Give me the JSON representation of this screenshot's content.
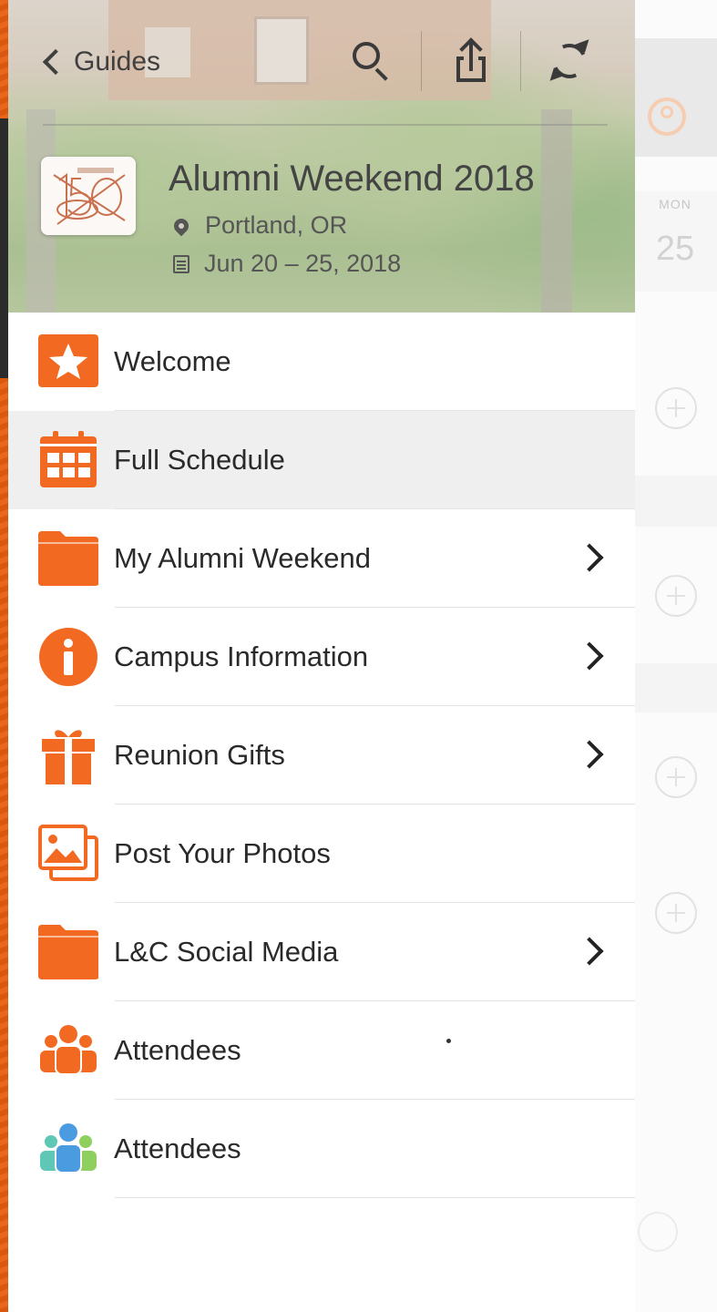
{
  "nav": {
    "back_label": "Guides",
    "actions": [
      "search-icon",
      "share-icon",
      "refresh-icon"
    ]
  },
  "event": {
    "title": "Alumni Weekend 2018",
    "location": "Portland, OR",
    "dates": "Jun 20 – 25, 2018",
    "logo_icon": "150-anniversary-logo"
  },
  "menu": {
    "items": [
      {
        "label": "Welcome",
        "icon": "star-icon",
        "has_chevron": false,
        "active": false
      },
      {
        "label": "Full Schedule",
        "icon": "calendar-grid-icon",
        "has_chevron": false,
        "active": true
      },
      {
        "label": "My Alumni Weekend",
        "icon": "folder-icon",
        "has_chevron": true,
        "active": false
      },
      {
        "label": "Campus Information",
        "icon": "info-icon",
        "has_chevron": true,
        "active": false
      },
      {
        "label": "Reunion Gifts",
        "icon": "gift-icon",
        "has_chevron": true,
        "active": false
      },
      {
        "label": "Post Your Photos",
        "icon": "photos-icon",
        "has_chevron": false,
        "active": false
      },
      {
        "label": "L&C Social Media",
        "icon": "folder-icon",
        "has_chevron": true,
        "active": false
      },
      {
        "label": "Attendees",
        "icon": "people-orange-icon",
        "has_chevron": false,
        "active": false
      },
      {
        "label": "Attendees",
        "icon": "people-colored-icon",
        "has_chevron": false,
        "active": false
      }
    ]
  },
  "background_calendar": {
    "day_of_week": "MON",
    "date": "25"
  },
  "colors": {
    "accent": "#f26a21",
    "text": "#2a2a2a",
    "active_row": "#efeff0",
    "divider": "#e3e3e3"
  }
}
